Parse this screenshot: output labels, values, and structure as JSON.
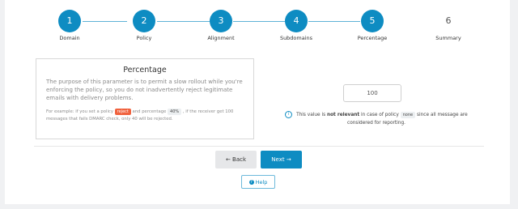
{
  "stepper": {
    "steps": [
      {
        "number": "1",
        "label": "Domain"
      },
      {
        "number": "2",
        "label": "Policy"
      },
      {
        "number": "3",
        "label": "Alignment"
      },
      {
        "number": "4",
        "label": "Subdomains"
      },
      {
        "number": "5",
        "label": "Percentage"
      },
      {
        "number": "6",
        "label": "Summary"
      }
    ]
  },
  "panel": {
    "title": "Percentage",
    "description": "The purpose of this parameter is to permit a slow rollout while you're enforcing the policy, so you do not inadvertently reject legitimate emails with delivery problems.",
    "example_prefix": "For example: if you set a policy",
    "example_policy_tag": "reject",
    "example_middle": "and percentage",
    "example_pct_tag": "40%",
    "example_suffix": ", if the receiver get 100 messages that fails DMARC check, only 40 will be rejected."
  },
  "percentage_input": {
    "value": "100"
  },
  "note": {
    "prefix": "This value is",
    "emphasis": "not relevant",
    "middle": "in case of policy",
    "tag": "none",
    "suffix": "since all message are considered for reporting."
  },
  "buttons": {
    "back": "← Back",
    "next": "Next →",
    "help": "Help"
  },
  "colors": {
    "accent": "#0e8cc2",
    "reject_tag": "#f0623e",
    "background": "#f0f1f3"
  }
}
